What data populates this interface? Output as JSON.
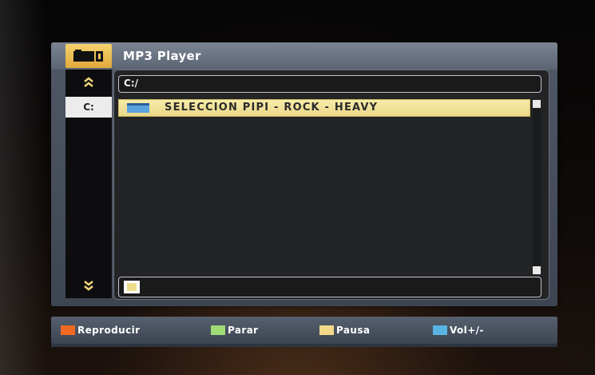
{
  "window": {
    "title": "MP3 Player",
    "path": "C:/"
  },
  "sidebar": {
    "up_icon": "double-chevron-up-icon",
    "drive_label": "C:",
    "down_icon": "double-chevron-down-icon"
  },
  "file_list": {
    "items": [
      {
        "name": "SELECCION PIPI - ROCK - HEAVY",
        "icon": "folder-icon",
        "selected": true
      }
    ]
  },
  "legend": {
    "items": [
      {
        "label": "Reproducir",
        "color": "#f06a24"
      },
      {
        "label": "Parar",
        "color": "#9fdc76"
      },
      {
        "label": "Pausa",
        "color": "#f3d888"
      },
      {
        "label": "Vol+/-",
        "color": "#58b4e3"
      }
    ]
  },
  "colors": {
    "accent_gold": "#e0a93c",
    "selected_row": "#f2e39b",
    "panel_bg": "#232426"
  }
}
